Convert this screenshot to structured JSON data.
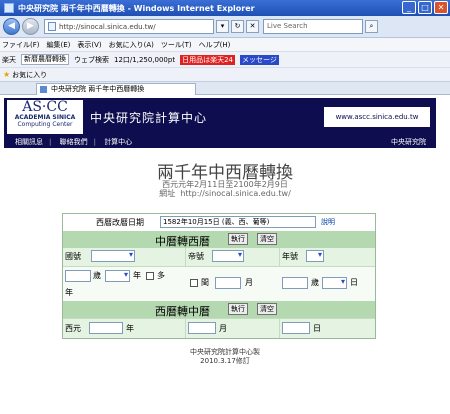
{
  "window": {
    "title": "中央研究院  兩千年中西曆轉換 - Windows Internet Explorer"
  },
  "address": {
    "url": "http://sinocal.sinica.edu.tw/",
    "search_placeholder": "Live Search"
  },
  "menu": [
    "ファイル(F)",
    "編集(E)",
    "表示(V)",
    "お気に入り(A)",
    "ツール(T)",
    "ヘルプ(H)"
  ],
  "toolbar": {
    "rakuten": "楽天",
    "search_field": "新暦農暦轉換",
    "web_search": "ウェブ検索",
    "points": "12口/1,250,000pt",
    "promo": "日用品は楽天24",
    "messenger": "メッセージ"
  },
  "favorites": {
    "label": "お気に入り"
  },
  "tab": {
    "label": "中央研究院 兩千年中西曆轉換"
  },
  "banner": {
    "logo_big": "AS·CC",
    "logo_line2": "ACADEMIA SINICA",
    "logo_line3": "Computing Center",
    "title": "中央研究院計算中心",
    "url": "www.ascc.sinica.edu.tw"
  },
  "nav": {
    "items": [
      "相關訊息",
      "聯絡我們",
      "計算中心"
    ],
    "right": "中央研究院"
  },
  "header": {
    "title": "兩千年中西曆轉換",
    "range": "西元元年2月11日至2100年2月9日",
    "site_label": "網址",
    "site_url": "http://sinocal.sinica.edu.tw/"
  },
  "converter": {
    "reform_label": "西曆改曆日期",
    "reform_value": "1582年10月15日 (義、西、葡等)",
    "explain": "說明",
    "c2w_title": "中曆轉西曆",
    "w2c_title": "西曆轉中曆",
    "run": "執行",
    "clear": "清空",
    "dynasty": "國號",
    "emperor": "帝號",
    "era": "年號",
    "year": "年",
    "leap": "閏",
    "month": "月",
    "day": "日",
    "yearday": "歲",
    "many": "多",
    "ad": "西元"
  },
  "footer": {
    "line1": "中央研究院計算中心製",
    "line2": "2010.3.17修訂"
  }
}
